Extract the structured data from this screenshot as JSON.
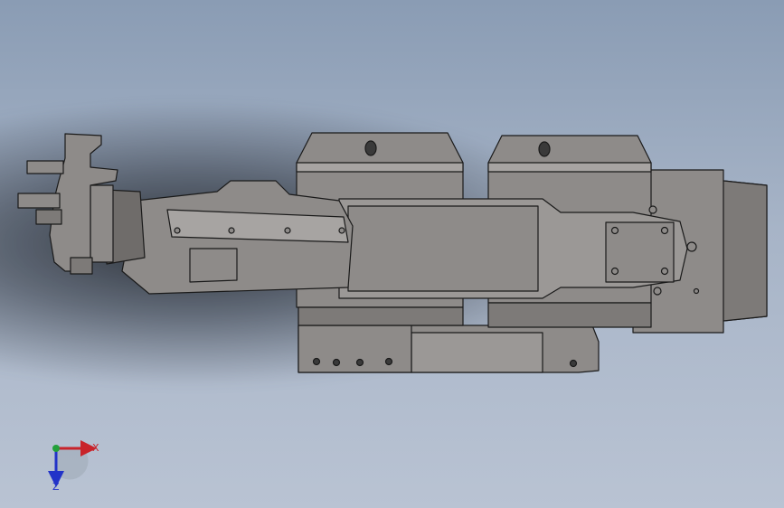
{
  "viewport": {
    "background_top": "#8a9cb4",
    "background_bottom": "#b9c3d3"
  },
  "model": {
    "body_color": "#8e8b89",
    "body_light": "#a7a4a2",
    "body_dark": "#6f6c6a",
    "edge_color": "#1a1a1a"
  },
  "triad": {
    "x_label": "X",
    "z_label": "Z",
    "x_color": "#c8232a",
    "z_color": "#2233c8",
    "y_color": "#22a03a"
  }
}
